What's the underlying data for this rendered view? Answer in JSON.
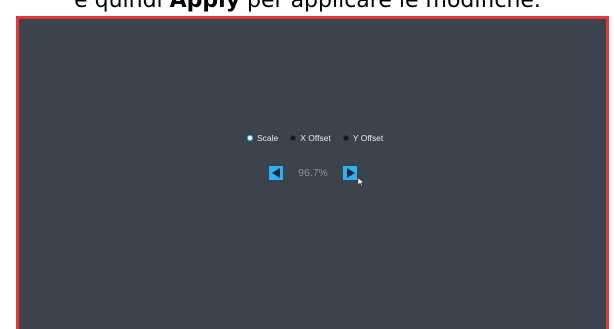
{
  "caption": {
    "pre": "e quindi ",
    "bold": "Apply",
    "post": " per applicare le modifiche."
  },
  "options": [
    {
      "label": "Scale",
      "selected": true
    },
    {
      "label": "X Offset",
      "selected": false
    },
    {
      "label": "Y Offset",
      "selected": false
    }
  ],
  "value": "96.7%",
  "controls": {
    "decrease_icon": "left-arrow-icon",
    "increase_icon": "right-arrow-icon"
  },
  "colors": {
    "accent": "#2fb2f2",
    "background": "#3b434d",
    "frame": "#e8343a"
  }
}
